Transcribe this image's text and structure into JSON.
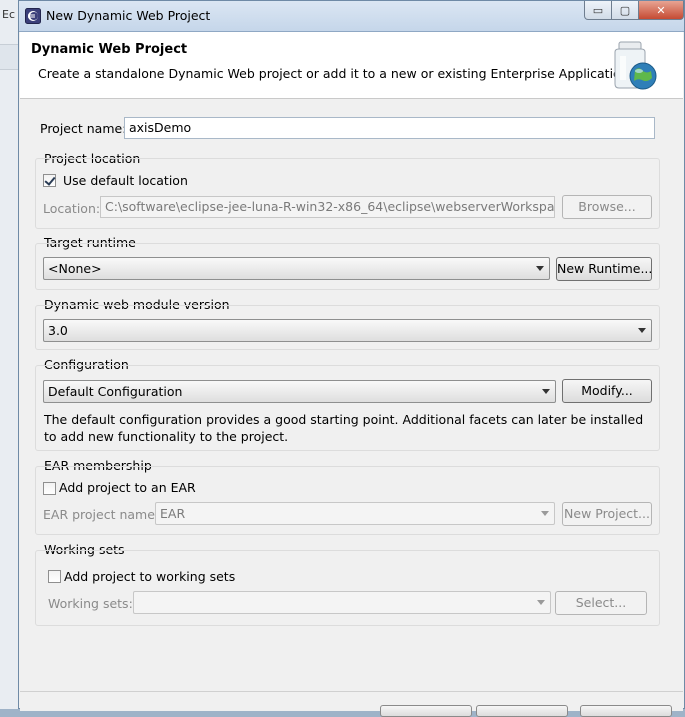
{
  "background": {
    "left_title": "Ec"
  },
  "window": {
    "title": "New Dynamic Web Project",
    "min_glyph": "▭",
    "max_glyph": "▢",
    "close_glyph": "✕"
  },
  "header": {
    "title": "Dynamic Web Project",
    "description": "Create a standalone Dynamic Web project or add it to a new or existing Enterprise Application.",
    "banner_icon": "web-project-jar-globe-icon"
  },
  "project_name": {
    "label": "Project name:",
    "value": "axisDemo"
  },
  "project_location": {
    "group_label": "Project location",
    "use_default_label": "Use default location",
    "use_default_checked": true,
    "location_label": "Location:",
    "location_value": "C:\\software\\eclipse-jee-luna-R-win32-x86_64\\eclipse\\webserverWorkspace\\axisDemo",
    "browse_label": "Browse..."
  },
  "target_runtime": {
    "group_label": "Target runtime",
    "selected": "<None>",
    "new_runtime_label": "New Runtime..."
  },
  "module_version": {
    "group_label": "Dynamic web module version",
    "selected": "3.0"
  },
  "configuration": {
    "group_label": "Configuration",
    "selected": "Default Configuration",
    "modify_label": "Modify...",
    "description": "The default configuration provides a good starting point. Additional facets can later be installed to add new functionality to the project."
  },
  "ear_membership": {
    "group_label": "EAR membership",
    "add_label": "Add project to an EAR",
    "add_checked": false,
    "ear_name_label": "EAR project name:",
    "ear_name_value": "EAR",
    "new_project_label": "New Project..."
  },
  "working_sets": {
    "group_label": "Working sets",
    "add_label": "Add project to working sets",
    "add_checked": false,
    "sets_label": "Working sets:",
    "sets_value": "",
    "select_label": "Select..."
  },
  "colors": {
    "title_bar": "#c9d9ec",
    "dialog_bg": "#f0f0f0",
    "close_button": "#c54b33"
  }
}
